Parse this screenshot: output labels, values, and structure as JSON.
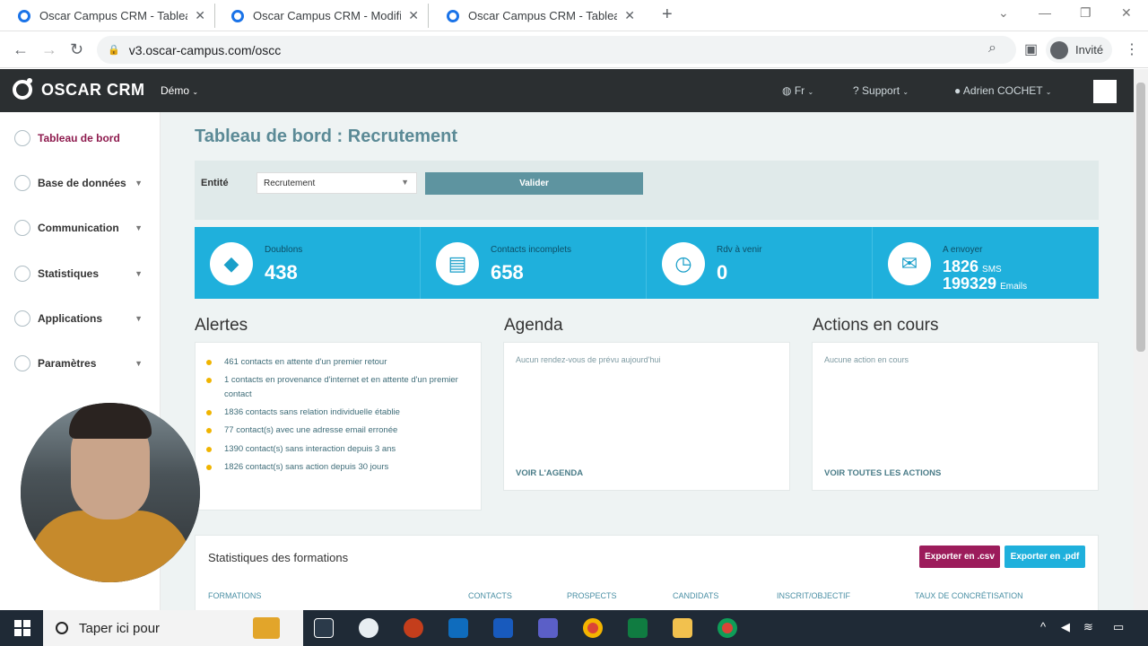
{
  "browser": {
    "tabs": [
      {
        "title": "Oscar Campus CRM - Tableau de"
      },
      {
        "title": "Oscar Campus CRM - Modificati"
      },
      {
        "title": "Oscar Campus CRM - Tableau de"
      }
    ],
    "url": "v3.oscar-campus.com/oscc",
    "profile_label": "Invité"
  },
  "app": {
    "logo_text": "OSCAR CRM",
    "workspace": "Démo",
    "language": "Fr",
    "support": "Support",
    "user": "Adrien COCHET"
  },
  "sidebar": {
    "items": [
      {
        "label": "Tableau de bord",
        "active": true,
        "icon": "dashboard-icon"
      },
      {
        "label": "Base de données",
        "icon": "database-icon"
      },
      {
        "label": "Communication",
        "icon": "chat-icon"
      },
      {
        "label": "Statistiques",
        "icon": "chart-icon"
      },
      {
        "label": "Applications",
        "icon": "apps-icon"
      },
      {
        "label": "Paramètres",
        "icon": "gear-icon"
      }
    ]
  },
  "page": {
    "title": "Tableau de bord : Recrutement",
    "filter": {
      "label": "Entité",
      "value": "Recrutement",
      "submit": "Valider"
    }
  },
  "kpis": [
    {
      "label": "Doublons",
      "value": "438",
      "icon": "layers-icon"
    },
    {
      "label": "Contacts incomplets",
      "value": "658",
      "icon": "clipboard-icon"
    },
    {
      "label": "Rdv à venir",
      "value": "0",
      "icon": "alarm-clock-icon"
    },
    {
      "label": "A envoyer",
      "sms_value": "1826",
      "sms_unit": "SMS",
      "email_value": "199329",
      "email_unit": "Emails",
      "icon": "messages-icon"
    }
  ],
  "alerts": {
    "title": "Alertes",
    "items": [
      "461 contacts en attente d'un premier retour",
      "1 contacts en provenance d'internet et en attente d'un premier contact",
      "1836 contacts sans relation individuelle établie",
      "77 contact(s) avec une adresse email erronée",
      "1390 contact(s) sans interaction depuis 3 ans",
      "1826 contact(s) sans action depuis 30 jours"
    ]
  },
  "agenda": {
    "title": "Agenda",
    "empty": "Aucun rendez-vous de prévu aujourd'hui",
    "link": "VOIR L'AGENDA"
  },
  "actions": {
    "title": "Actions en cours",
    "empty": "Aucune action en cours",
    "link": "VOIR TOUTES LES ACTIONS"
  },
  "stats": {
    "title": "Statistiques des formations",
    "export_csv": "Exporter en .csv",
    "export_pdf": "Exporter en .pdf",
    "columns": [
      "FORMATIONS",
      "CONTACTS",
      "PROSPECTS",
      "CANDIDATS",
      "INSCRIT/OBJECTIF",
      "TAUX DE CONCRÉTISATION"
    ]
  },
  "taskbar": {
    "search_placeholder": "Taper ici pour"
  },
  "colors": {
    "topnav": "#2b2f31",
    "accent_blue": "#1fb0dc",
    "title_teal": "#5b8a96",
    "csv_button": "#9c1c5b",
    "pdf_button": "#1fb0dc",
    "active_sidebar": "#8e1b4e"
  }
}
